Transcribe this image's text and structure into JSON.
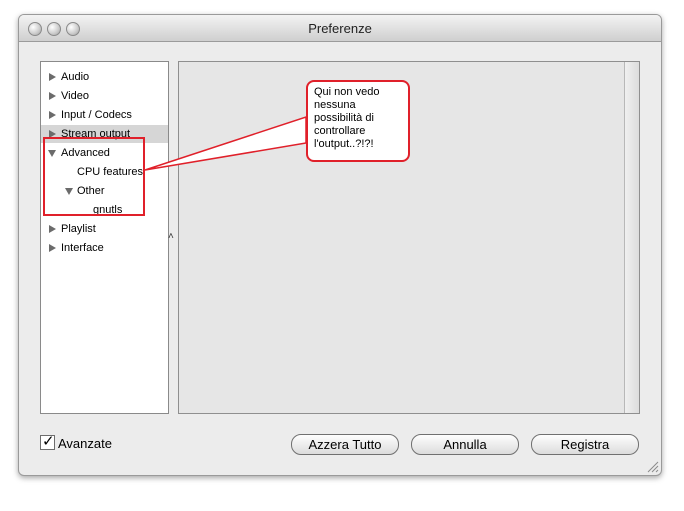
{
  "window": {
    "title": "Preferenze"
  },
  "sidebar": {
    "items": [
      {
        "label": "Audio"
      },
      {
        "label": "Video"
      },
      {
        "label": "Input / Codecs"
      },
      {
        "label": "Stream output"
      },
      {
        "label": "Advanced"
      },
      {
        "label": "CPU features"
      },
      {
        "label": "Other"
      },
      {
        "label": "gnutls"
      },
      {
        "label": "Playlist"
      },
      {
        "label": "Interface"
      }
    ]
  },
  "footer": {
    "checkbox_label": "Avanzate",
    "buttons": [
      "Azzera Tutto",
      "Annulla",
      "Registra"
    ]
  },
  "annotation": {
    "text": "Qui non vedo nessuna possibilità di controllare l'output..?!?!"
  },
  "colors": {
    "annotation": "#e0202a",
    "selection": "#d6d6d6"
  }
}
